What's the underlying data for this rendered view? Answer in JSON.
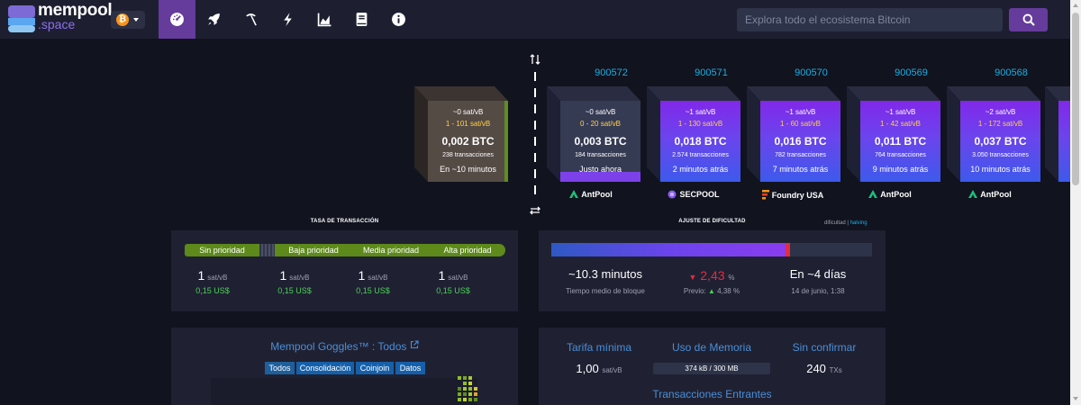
{
  "header": {
    "logo_name": "mempool",
    "logo_suffix": ".space",
    "network_symbol": "₿",
    "nav_icons": [
      "dashboard-icon",
      "rocket-icon",
      "pickaxe-icon",
      "lightning-icon",
      "chart-icon",
      "book-icon",
      "info-icon"
    ],
    "search_placeholder": "Explora todo el ecosistema Bitcoin"
  },
  "mempool_block": {
    "fee": "~0 sat/vB",
    "range": "1 - 101 sat/vB",
    "size": "0,002 BTC",
    "tx_count": "238 transacciones",
    "eta": "En ~10 minutos"
  },
  "blocks": [
    {
      "height": "900572",
      "fee": "~0 sat/vB",
      "range": "0 - 20 sat/vB",
      "size": "0,003 BTC",
      "tx_count": "184 transacciones",
      "time": "Justo ahora",
      "pool": "AntPool",
      "pool_icon": "antpool-icon"
    },
    {
      "height": "900571",
      "fee": "~1 sat/vB",
      "range": "1 - 130 sat/vB",
      "size": "0,018 BTC",
      "tx_count": "2.574 transacciones",
      "time": "2 minutos atrás",
      "pool": "SECPOOL",
      "pool_icon": "secpool-icon"
    },
    {
      "height": "900570",
      "fee": "~1 sat/vB",
      "range": "1 - 60 sat/vB",
      "size": "0,016 BTC",
      "tx_count": "782 transacciones",
      "time": "7 minutos atrás",
      "pool": "Foundry USA",
      "pool_icon": "foundry-icon"
    },
    {
      "height": "900569",
      "fee": "~1 sat/vB",
      "range": "1 - 42 sat/vB",
      "size": "0,011 BTC",
      "tx_count": "764 transacciones",
      "time": "9 minutos atrás",
      "pool": "AntPool",
      "pool_icon": "antpool-icon"
    },
    {
      "height": "900568",
      "fee": "~2 sat/vB",
      "range": "1 - 172 sat/vB",
      "size": "0,037 BTC",
      "tx_count": "3.050 transacciones",
      "time": "10 minutos atrás",
      "pool": "AntPool",
      "pool_icon": "antpool-icon"
    }
  ],
  "fees": {
    "title": "TASA DE TRANSACCIÓN",
    "labels": [
      "Sin prioridad",
      "Baja prioridad",
      "Media prioridad",
      "Alta prioridad"
    ],
    "values": [
      "1",
      "1",
      "1",
      "1"
    ],
    "unit": "sat/vB",
    "usd": [
      "0,15 US$",
      "0,15 US$",
      "0,15 US$",
      "0,15 US$"
    ]
  },
  "difficulty": {
    "title": "AJUSTE DE DIFICULTAD",
    "toggle_a": "dificultad",
    "toggle_sep": "|",
    "toggle_b": "halving",
    "progress_fraction": 0.73,
    "avg_block_time": "~10.3 minutos",
    "avg_block_label": "Tiempo medio de bloque",
    "change": "2,43",
    "change_unit": "%",
    "prev_label": "Previo:",
    "prev_value": "4,38",
    "eta": "En ~4 días",
    "eta_date": "14 de junio, 1:38"
  },
  "goggles": {
    "title": "Mempool Goggles™ : Todos",
    "tabs": [
      "Todos",
      "Consolidación",
      "Coinjoin",
      "Datos"
    ]
  },
  "stats": {
    "min_fee_label": "Tarifa mínima",
    "min_fee_value": "1,00",
    "min_fee_unit": "sat/vB",
    "memory_label": "Uso de Memoria",
    "memory_value": "374 kB / 300 MB",
    "unconfirmed_label": "Sin confirmar",
    "unconfirmed_value": "240",
    "unconfirmed_unit": "TXs",
    "incoming_label": "Transacciones Entrantes"
  },
  "colors": {
    "accent": "#653b9c",
    "link": "#1aafe2",
    "green": "#4ecf59",
    "red": "#e42b40"
  }
}
